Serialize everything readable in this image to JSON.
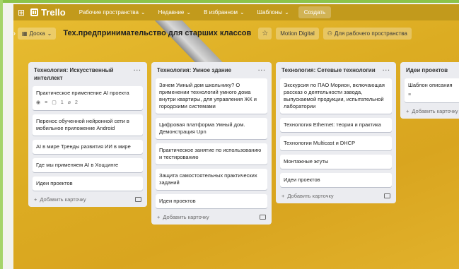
{
  "header": {
    "logo_text": "Trello",
    "menus": [
      {
        "label": "Рабочие пространства"
      },
      {
        "label": "Недавние"
      },
      {
        "label": "В избранном"
      },
      {
        "label": "Шаблоны"
      }
    ],
    "create_label": "Создать"
  },
  "boardbar": {
    "view_label": "Доска",
    "title": "Тех.предпринимательство для старших классов",
    "workspace_label": "Motion Digital",
    "workspace_visibility_label": "Для рабочего пространства"
  },
  "add_card_label": "Добавить карточку",
  "lists": [
    {
      "title": "Технология: Искусственный интеллект",
      "cards": [
        {
          "text": "Практическое применение AI проекта",
          "badges": {
            "comments": "1",
            "attachments": "2"
          }
        },
        {
          "text": "Перенос обученной нейронной сети в мобильное приложение Android"
        },
        {
          "text": "AI в мире Тренды развития ИИ в мире"
        },
        {
          "text": "Где мы применяем AI в Хоццинге"
        },
        {
          "text": "Идеи проектов"
        }
      ]
    },
    {
      "title": "Технология: Умное здание",
      "cards": [
        {
          "text": "Зачем Умный дом школьнику? О применении технологий умного дома внутри квартиры, для управления ЖК и городскими системами"
        },
        {
          "text": "Цифровая платформа Умный дом. Демонстрация Upn"
        },
        {
          "text": "Практическое занятие по использованию и тестированию"
        },
        {
          "text": "Защита самостоятельных практических заданий"
        },
        {
          "text": "Идеи проектов"
        }
      ]
    },
    {
      "title": "Технология: Сетевые технологии",
      "cards": [
        {
          "text": "Экскурсия по ПАО Морион, включающая рассказ о деятельности завода, выпускаемой продукции, испытательной лаборатории"
        },
        {
          "text": "Технология Ethernet: теория и практика"
        },
        {
          "text": "Технологии Multicast и DHCP"
        },
        {
          "text": "Монтажные жгуты"
        },
        {
          "text": "Идеи проектов"
        }
      ]
    },
    {
      "title": "Идеи проектов",
      "cards": [
        {
          "text": "Шаблон описания"
        }
      ]
    }
  ]
}
